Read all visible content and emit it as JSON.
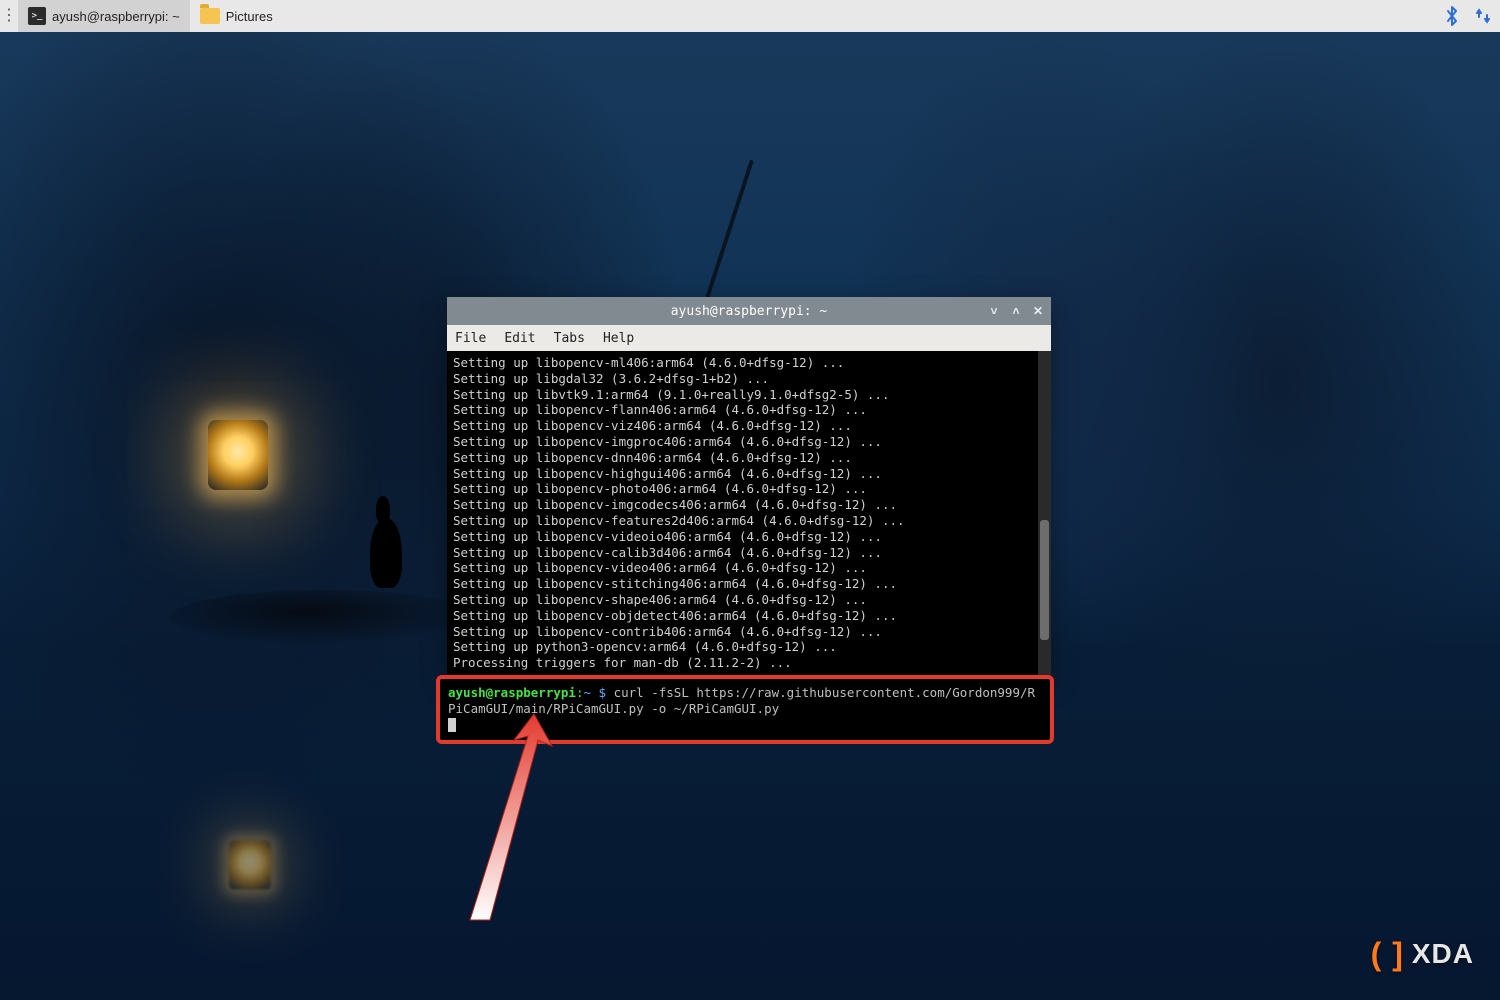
{
  "taskbar": {
    "items": [
      {
        "label": "ayush@raspberrypi: ~",
        "icon": "terminal",
        "active": true
      },
      {
        "label": "Pictures",
        "icon": "folder",
        "active": false
      }
    ],
    "tray": {
      "bluetooth": true,
      "network": true
    }
  },
  "terminal": {
    "title": "ayush@raspberrypi: ~",
    "menus": {
      "file": "File",
      "edit": "Edit",
      "tabs": "Tabs",
      "help": "Help"
    },
    "output": [
      "Setting up libopencv-ml406:arm64 (4.6.0+dfsg-12) ...",
      "Setting up libgdal32 (3.6.2+dfsg-1+b2) ...",
      "Setting up libvtk9.1:arm64 (9.1.0+really9.1.0+dfsg2-5) ...",
      "Setting up libopencv-flann406:arm64 (4.6.0+dfsg-12) ...",
      "Setting up libopencv-viz406:arm64 (4.6.0+dfsg-12) ...",
      "Setting up libopencv-imgproc406:arm64 (4.6.0+dfsg-12) ...",
      "Setting up libopencv-dnn406:arm64 (4.6.0+dfsg-12) ...",
      "Setting up libopencv-highgui406:arm64 (4.6.0+dfsg-12) ...",
      "Setting up libopencv-photo406:arm64 (4.6.0+dfsg-12) ...",
      "Setting up libopencv-imgcodecs406:arm64 (4.6.0+dfsg-12) ...",
      "Setting up libopencv-features2d406:arm64 (4.6.0+dfsg-12) ...",
      "Setting up libopencv-videoio406:arm64 (4.6.0+dfsg-12) ...",
      "Setting up libopencv-calib3d406:arm64 (4.6.0+dfsg-12) ...",
      "Setting up libopencv-video406:arm64 (4.6.0+dfsg-12) ...",
      "Setting up libopencv-stitching406:arm64 (4.6.0+dfsg-12) ...",
      "Setting up libopencv-shape406:arm64 (4.6.0+dfsg-12) ...",
      "Setting up libopencv-objdetect406:arm64 (4.6.0+dfsg-12) ...",
      "Setting up libopencv-contrib406:arm64 (4.6.0+dfsg-12) ...",
      "Setting up python3-opencv:arm64 (4.6.0+dfsg-12) ...",
      "Processing triggers for man-db (2.11.2-2) ..."
    ],
    "prompt": {
      "user_host": "ayush@raspberrypi",
      "separator": ":",
      "cwd": "~",
      "symbol": "$",
      "command": "curl -fsSL https://raw.githubusercontent.com/Gordon999/RPiCamGUI/main/RPiCamGUI.py -o ~/RPiCamGUI.py"
    }
  },
  "watermark": {
    "text": "XDA"
  },
  "colors": {
    "highlight_border": "#e23b2e",
    "prompt_user": "#46e246",
    "prompt_path": "#6aa7ff",
    "titlebar": "#808a90"
  }
}
